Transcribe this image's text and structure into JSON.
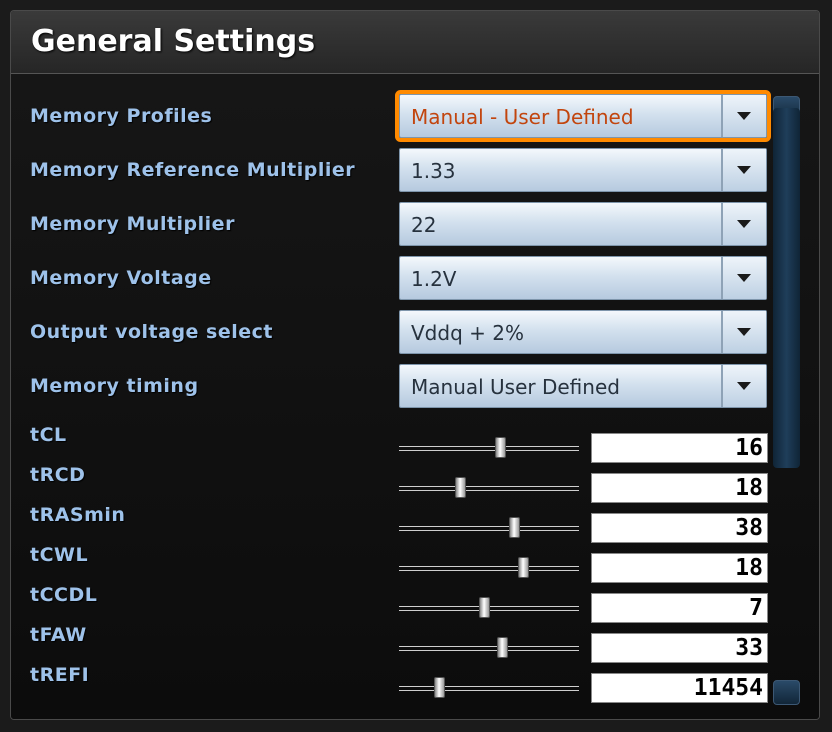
{
  "title": "General Settings",
  "settings": [
    {
      "label": "Memory Profiles",
      "value": "Manual - User Defined",
      "focused": true
    },
    {
      "label": "Memory Reference Multiplier",
      "value": "1.33"
    },
    {
      "label": "Memory Multiplier",
      "value": "22"
    },
    {
      "label": "Memory Voltage",
      "value": "1.2V"
    },
    {
      "label": "Output voltage select",
      "value": "Vddq + 2%"
    },
    {
      "label": "Memory timing",
      "value": "Manual  User Defined"
    }
  ],
  "timings": [
    {
      "label": "tCL",
      "value": "16",
      "slider_fraction": 0.56
    },
    {
      "label": "tRCD",
      "value": "18",
      "slider_fraction": 0.34
    },
    {
      "label": "tRASmin",
      "value": "38",
      "slider_fraction": 0.64
    },
    {
      "label": "tCWL",
      "value": "18",
      "slider_fraction": 0.69
    },
    {
      "label": "tCCDL",
      "value": "7",
      "slider_fraction": 0.47
    },
    {
      "label": "tFAW",
      "value": "33",
      "slider_fraction": 0.57
    },
    {
      "label": "tREFI",
      "value": "11454",
      "slider_fraction": 0.22
    }
  ],
  "colors": {
    "label": "#9ec2ea",
    "focus_outline": "#ff8a00",
    "focused_value": "#c2450e"
  }
}
